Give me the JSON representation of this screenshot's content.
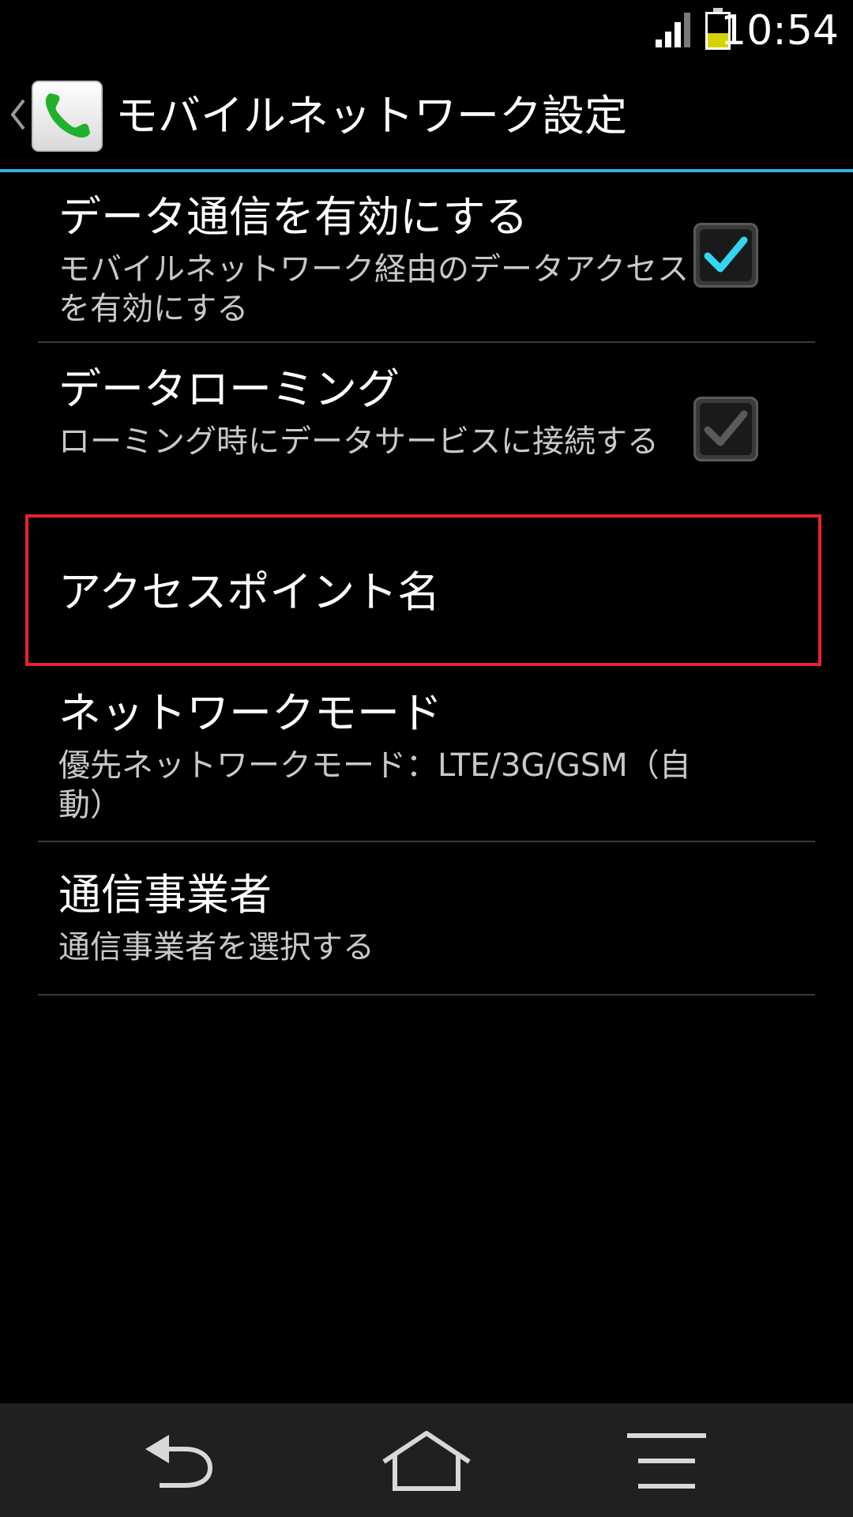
{
  "status_bar": {
    "time": "10:54",
    "icons": [
      "signal-icon",
      "battery-icon"
    ]
  },
  "action_bar": {
    "title": "モバイルネットワーク設定",
    "icon": "phone-app-icon"
  },
  "preferences": [
    {
      "title": "データ通信を有効にする",
      "summary": "モバイルネットワーク経由のデータアクセスを有効にする",
      "checkbox": true,
      "checked": true
    },
    {
      "title": "データローミング",
      "summary": "ローミング時にデータサービスに接続する",
      "checkbox": true,
      "checked": false
    },
    {
      "title": "アクセスポイント名",
      "summary": "",
      "checkbox": false,
      "highlighted": true
    },
    {
      "title": "ネットワークモード",
      "summary": "優先ネットワークモード：LTE/3G/GSM（自動）",
      "checkbox": false
    },
    {
      "title": "通信事業者",
      "summary": "通信事業者を選択する",
      "checkbox": false
    }
  ],
  "nav_bar": {
    "buttons": [
      "back-icon",
      "home-icon",
      "menu-icon"
    ]
  },
  "colors": {
    "accent": "#33b5e5",
    "highlight_border": "#e8232b",
    "battery_level": "#d4d400"
  }
}
